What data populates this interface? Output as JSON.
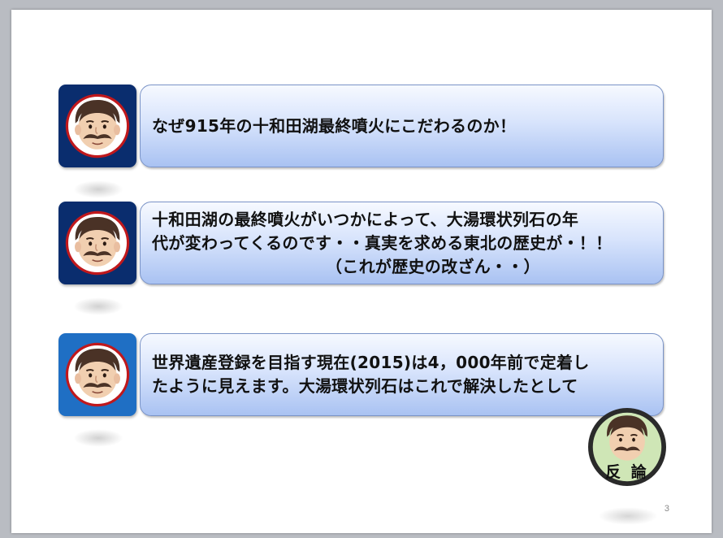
{
  "slide": {
    "page_number": "3",
    "rows": [
      {
        "tile_color": "#0a2d6e",
        "lines": [
          "なぜ915年の十和田湖最終噴火にこだわるのか！"
        ]
      },
      {
        "tile_color": "#0a2d6e",
        "lines": [
          "十和田湖の最終噴火がいつかによって、大湯環状列石の年",
          "代が変わってくるのです・・真実を求める東北の歴史が・！！",
          "（これが歴史の改ざん・・）"
        ]
      },
      {
        "tile_color": "#1f6fc4",
        "lines": [
          "世界遺産登録を目指す現在(2015)は4，000年前で定着し",
          "たように見えます。大湯環状列石はこれで解決したとして"
        ]
      }
    ],
    "rebuttal": {
      "label": "反 論",
      "ring_color": "#2a2a2a",
      "background_color": "#cfe6b6"
    }
  }
}
